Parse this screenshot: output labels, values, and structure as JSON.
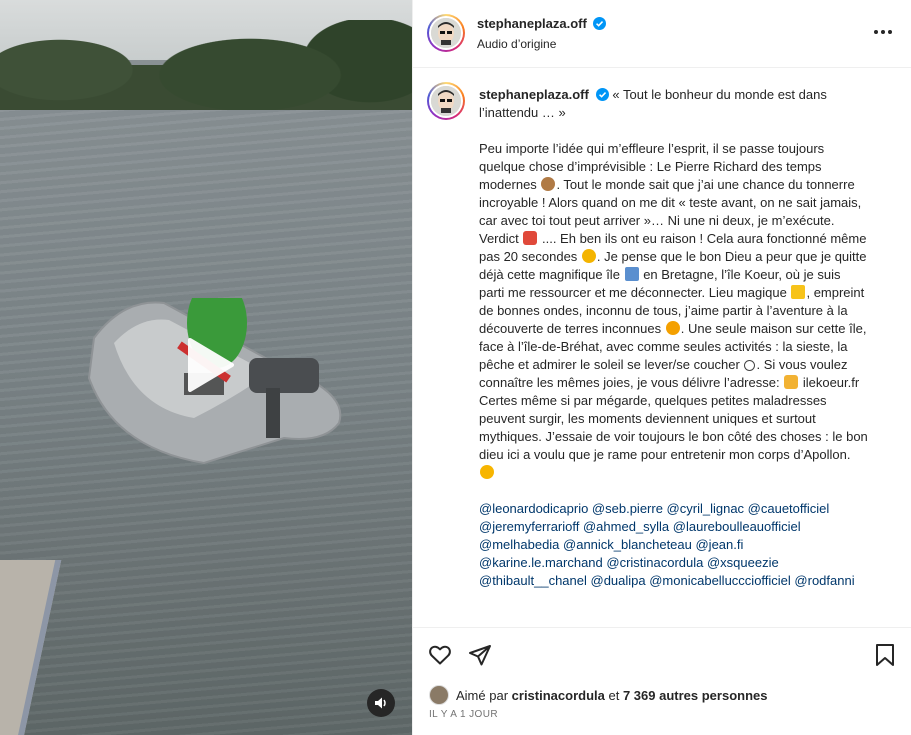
{
  "post": {
    "username": "stephaneplaza.off",
    "audio_label": "Audio d’origine",
    "more_icon": "more-horizontal-icon"
  },
  "caption": {
    "username": "stephaneplaza.off",
    "title": "« Tout le bonheur du monde est dans l’inattendu … »",
    "p1": "Peu importe l’idée qui m’effleure l’esprit, il se passe toujours quelque chose d’imprévisible : Le Pierre Richard des temps modernes",
    "p1b": ". Tout le monde sait que j’ai une chance du tonnerre incroyable ! Alors quand on me dit « teste avant, on ne sait jamais, car avec toi tout peut arriver »… Ni une ni deux, je m’exécute.",
    "p2a": "Verdict",
    "p2b": ".... Eh ben ils ont eu raison ! Cela aura fonctionné même pas 20 secondes",
    "p2c": ". Je pense que le bon Dieu a peur que je quitte déjà cette magnifique île",
    "p2d": "en Bretagne, l’île Koeur, où je suis parti me ressourcer et me déconnecter. Lieu magique",
    "p2e": ", empreint de bonnes ondes, inconnu de tous, j’aime partir à l’aventure à la découverte de terres inconnues",
    "p2f": ". Une seule maison sur cette île, face à l’île-de-Bréhat, avec comme seules activités : la sieste, la pêche et admirer le soleil se lever/se coucher",
    "p2g": ". Si vous voulez connaître les mêmes joies, je vous délivre l’adresse:",
    "p2h": "ilekoeur.fr",
    "p3a": "Certes même si par mégarde, quelques petites maladresses peuvent surgir, les moments deviennent uniques et surtout mythiques. J’essaie de voir toujours le bon côté des choses : le bon dieu ici a voulu que je rame pour entretenir mon corps d’Apollon.",
    "mentions_line1": "@leonardodicaprio @seb.pierre @cyril_lignac @cauetofficiel",
    "mentions_line2": "@jeremyferrarioff @ahmed_sylla @laureboulleauofficiel",
    "mentions_line3": "@melhabedia @annick_blancheteau @jean.fi",
    "mentions_line4": "@karine.le.marchand @cristinacordula @xsqueezie",
    "mentions_line5": "@thibault__chanel @dualipa @monicabelluccciofficiel @rodfanni",
    "emojis": [
      "see-no-evil-monkey",
      "crazy-face",
      "worried-face",
      "desert-island",
      "sparkles",
      "star-struck",
      "copyright-smile",
      "pointing-hand",
      "smiling-face-hearts"
    ]
  },
  "engagement": {
    "liked_by_prefix": "Aimé par",
    "liked_by_user": "cristinacordula",
    "liked_by_conjunction": "et",
    "liked_by_count": "7 369 autres personnes",
    "timestamp": "Il y a 1 jour"
  },
  "icons": {
    "like": "heart-icon",
    "share": "send-icon",
    "save": "bookmark-icon",
    "play": "play-icon",
    "sound": "speaker-icon",
    "verified": "verified-badge-icon"
  }
}
